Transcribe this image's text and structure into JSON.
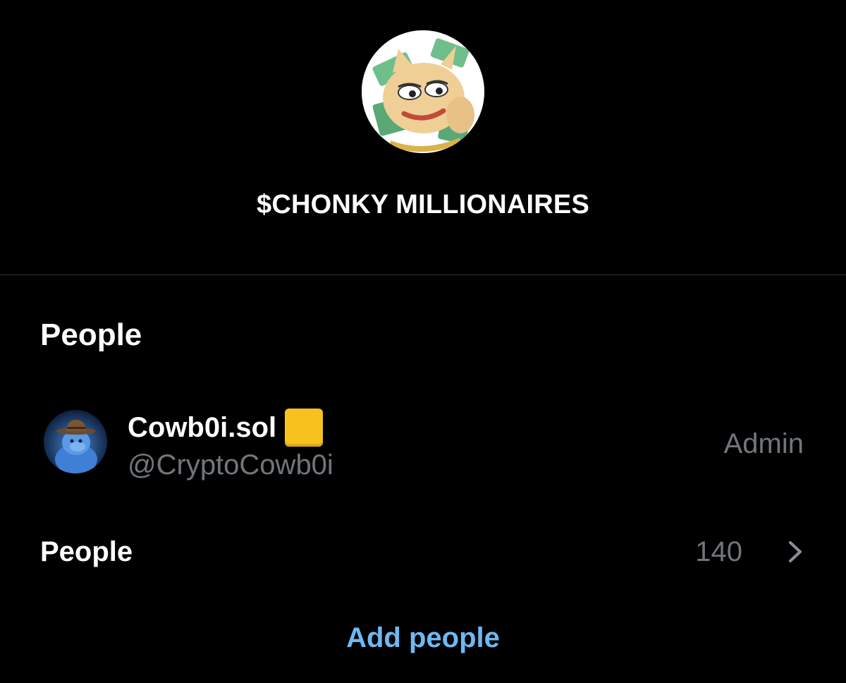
{
  "group": {
    "title": "$CHONKY MILLIONAIRES",
    "avatar_icon": "meme-cat-money-avatar"
  },
  "people_section": {
    "heading": "People",
    "members": [
      {
        "name": "Cowb0i.sol",
        "badge_icon": "yellow-square-emoji",
        "handle": "@CryptoCowb0i",
        "role": "Admin",
        "avatar_icon": "cowboy-gorilla-avatar"
      }
    ],
    "people_row": {
      "label": "People",
      "count": "140",
      "chevron_icon": "chevron-right-icon"
    },
    "add_people_label": "Add people"
  },
  "colors": {
    "background": "#000000",
    "primary_text": "#ffffff",
    "secondary_text": "#71767b",
    "link": "#6fb8f2",
    "divider": "#2f3336",
    "badge_yellow": "#f7c21e"
  }
}
